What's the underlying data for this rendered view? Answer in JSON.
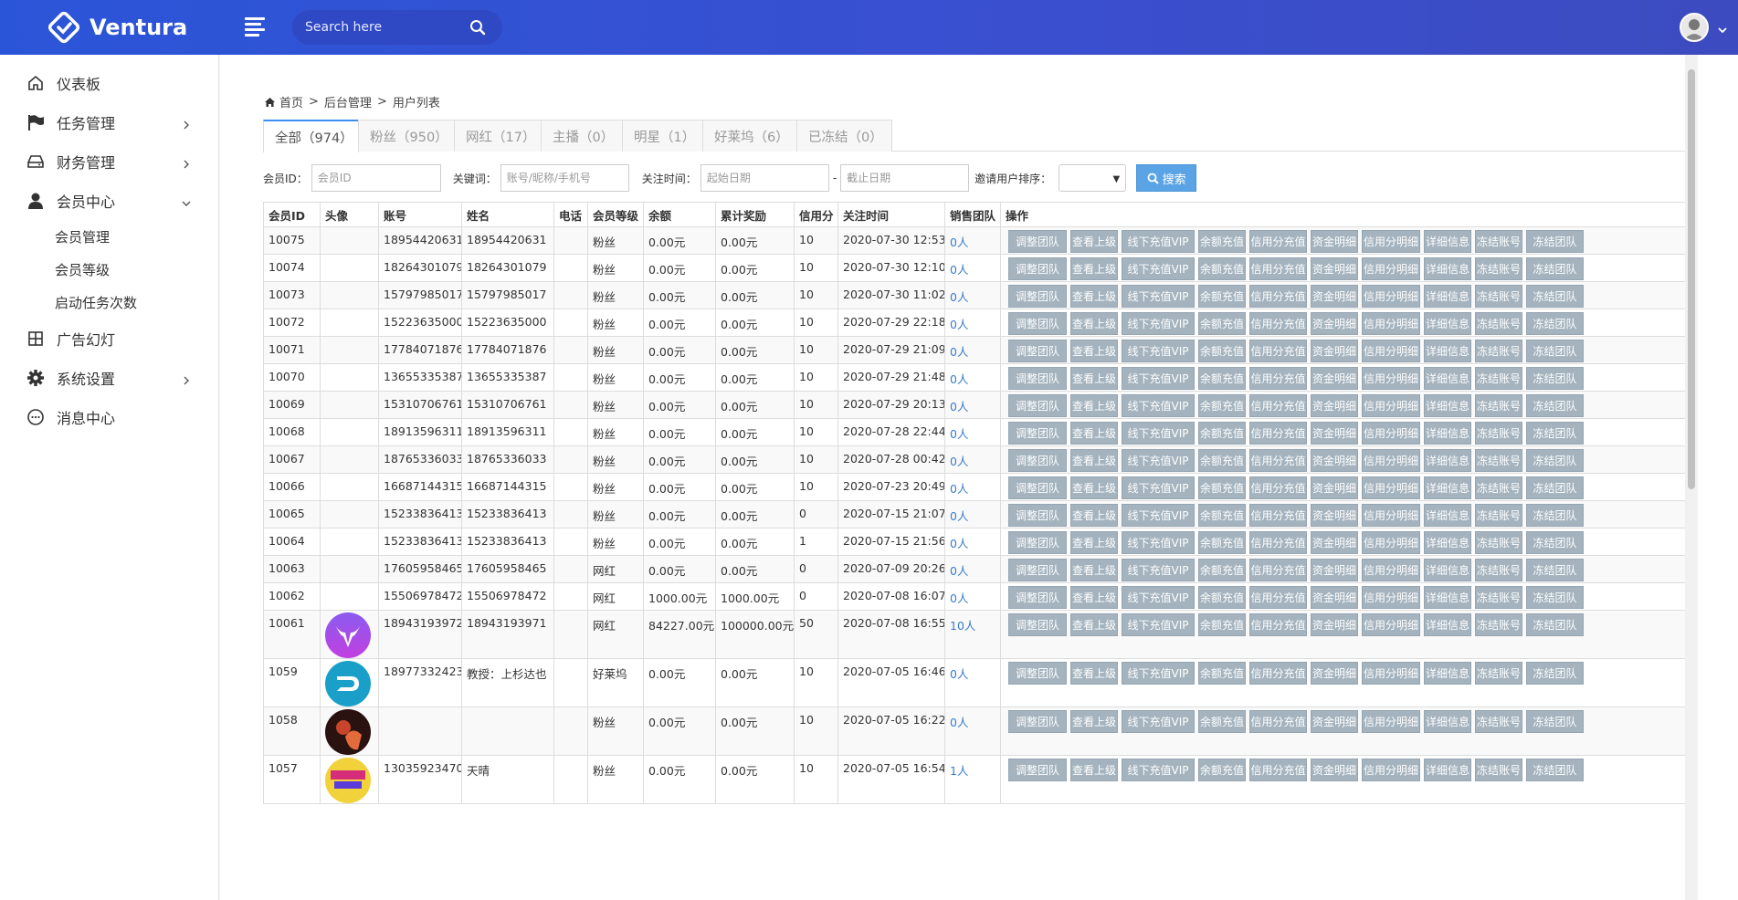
{
  "app": {
    "brand": "Ventura"
  },
  "search": {
    "placeholder": "Search here"
  },
  "sidebar": {
    "items": [
      {
        "label": "仪表板",
        "icon": "home-icon"
      },
      {
        "label": "任务管理",
        "icon": "flag-icon",
        "arrow": "chevron-right"
      },
      {
        "label": "财务管理",
        "icon": "hdd-icon",
        "arrow": "chevron-right"
      },
      {
        "label": "会员中心",
        "icon": "user-icon",
        "arrow": "chevron-down"
      },
      {
        "label": "广告幻灯",
        "icon": "grid-icon"
      },
      {
        "label": "系统设置",
        "icon": "gear-icon",
        "arrow": "chevron-right"
      },
      {
        "label": "消息中心",
        "icon": "chat-icon"
      }
    ],
    "member_sub": [
      "会员管理",
      "会员等级",
      "启动任务次数"
    ]
  },
  "breadcrumb": {
    "home": "首页",
    "sep": ">",
    "level1": "后台管理",
    "level2": "用户列表"
  },
  "tabs": [
    {
      "label": "全部（974）",
      "active": true
    },
    {
      "label": "粉丝（950）"
    },
    {
      "label": "网红（17）"
    },
    {
      "label": "主播（0）"
    },
    {
      "label": "明星（1）"
    },
    {
      "label": "好莱坞（6）"
    },
    {
      "label": "已冻结（0）"
    }
  ],
  "filters": {
    "member_id_label": "会员ID：",
    "member_id_placeholder": "会员ID",
    "keyword_label": "关键词：",
    "keyword_placeholder": "账号/昵称/手机号",
    "time_label": "关注时间：",
    "start_placeholder": "起始日期",
    "dash": "-",
    "end_placeholder": "截止日期",
    "sort_label": "邀请用户排序：",
    "search_button": "搜索"
  },
  "table": {
    "headers": [
      "会员ID",
      "头像",
      "账号",
      "姓名",
      "电话",
      "会员等级",
      "余额",
      "累计奖励",
      "信用分",
      "关注时间",
      "销售团队",
      "操作"
    ],
    "ops": [
      "调整团队",
      "查看上级",
      "线下充值VIP",
      "余额充值",
      "信用分充值",
      "资金明细",
      "信用分明细",
      "详细信息",
      "冻结账号",
      "冻结团队"
    ],
    "rows": [
      {
        "id": "10075",
        "account": "18954420631",
        "name": "18954420631",
        "phone": "",
        "level": "粉丝",
        "balance": "0.00元",
        "reward": "0.00元",
        "credit": "10",
        "time": "2020-07-30 12:53",
        "team": "0人"
      },
      {
        "id": "10074",
        "account": "18264301079",
        "name": "18264301079",
        "phone": "",
        "level": "粉丝",
        "balance": "0.00元",
        "reward": "0.00元",
        "credit": "10",
        "time": "2020-07-30 12:10",
        "team": "0人"
      },
      {
        "id": "10073",
        "account": "15797985017",
        "name": "15797985017",
        "phone": "",
        "level": "粉丝",
        "balance": "0.00元",
        "reward": "0.00元",
        "credit": "10",
        "time": "2020-07-30 11:02",
        "team": "0人"
      },
      {
        "id": "10072",
        "account": "15223635000",
        "name": "15223635000",
        "phone": "",
        "level": "粉丝",
        "balance": "0.00元",
        "reward": "0.00元",
        "credit": "10",
        "time": "2020-07-29 22:18",
        "team": "0人"
      },
      {
        "id": "10071",
        "account": "17784071876",
        "name": "17784071876",
        "phone": "",
        "level": "粉丝",
        "balance": "0.00元",
        "reward": "0.00元",
        "credit": "10",
        "time": "2020-07-29 21:09",
        "team": "0人"
      },
      {
        "id": "10070",
        "account": "13655335387",
        "name": "13655335387",
        "phone": "",
        "level": "粉丝",
        "balance": "0.00元",
        "reward": "0.00元",
        "credit": "10",
        "time": "2020-07-29 21:48",
        "team": "0人"
      },
      {
        "id": "10069",
        "account": "15310706761",
        "name": "15310706761",
        "phone": "",
        "level": "粉丝",
        "balance": "0.00元",
        "reward": "0.00元",
        "credit": "10",
        "time": "2020-07-29 20:13",
        "team": "0人"
      },
      {
        "id": "10068",
        "account": "18913596311",
        "name": "18913596311",
        "phone": "",
        "level": "粉丝",
        "balance": "0.00元",
        "reward": "0.00元",
        "credit": "10",
        "time": "2020-07-28 22:44",
        "team": "0人"
      },
      {
        "id": "10067",
        "account": "18765336033",
        "name": "18765336033",
        "phone": "",
        "level": "粉丝",
        "balance": "0.00元",
        "reward": "0.00元",
        "credit": "10",
        "time": "2020-07-28 00:42",
        "team": "0人"
      },
      {
        "id": "10066",
        "account": "16687144315",
        "name": "16687144315",
        "phone": "",
        "level": "粉丝",
        "balance": "0.00元",
        "reward": "0.00元",
        "credit": "10",
        "time": "2020-07-23 20:49",
        "team": "0人"
      },
      {
        "id": "10065",
        "account": "15233836413",
        "name": "15233836413",
        "phone": "",
        "level": "粉丝",
        "balance": "0.00元",
        "reward": "0.00元",
        "credit": "0",
        "time": "2020-07-15 21:07",
        "team": "0人"
      },
      {
        "id": "10064",
        "account": "15233836413",
        "name": "15233836413",
        "phone": "",
        "level": "粉丝",
        "balance": "0.00元",
        "reward": "0.00元",
        "credit": "1",
        "time": "2020-07-15 21:56",
        "team": "0人"
      },
      {
        "id": "10063",
        "account": "17605958465",
        "name": "17605958465",
        "phone": "",
        "level": "网红",
        "balance": "0.00元",
        "reward": "0.00元",
        "credit": "0",
        "time": "2020-07-09 20:26",
        "team": "0人"
      },
      {
        "id": "10062",
        "account": "15506978472",
        "name": "15506978472",
        "phone": "",
        "level": "网红",
        "balance": "1000.00元",
        "reward": "1000.00元",
        "credit": "0",
        "time": "2020-07-08 16:07",
        "team": "0人"
      },
      {
        "id": "10061",
        "account": "18943193972",
        "name": "18943193971",
        "phone": "",
        "level": "网红",
        "balance": "84227.00元",
        "reward": "100000.00元",
        "credit": "50",
        "time": "2020-07-08 16:55",
        "team": "10人",
        "avatar": "bull-avatar"
      },
      {
        "id": "1059",
        "account": "18977332423",
        "name": "教授：上杉达也",
        "phone": "",
        "level": "好莱坞",
        "balance": "0.00元",
        "reward": "0.00元",
        "credit": "10",
        "time": "2020-07-05 16:46",
        "team": "0人",
        "avatar": "d-logo-avatar"
      },
      {
        "id": "1058",
        "account": "",
        "name": "",
        "phone": "",
        "level": "粉丝",
        "balance": "0.00元",
        "reward": "0.00元",
        "credit": "10",
        "time": "2020-07-05 16:22",
        "team": "0人",
        "avatar": "photo-avatar"
      },
      {
        "id": "1057",
        "account": "13035923470",
        "name": "天晴",
        "phone": "",
        "level": "粉丝",
        "balance": "0.00元",
        "reward": "0.00元",
        "credit": "10",
        "time": "2020-07-05 16:54",
        "team": "1人",
        "avatar": "colorful-avatar"
      }
    ]
  }
}
